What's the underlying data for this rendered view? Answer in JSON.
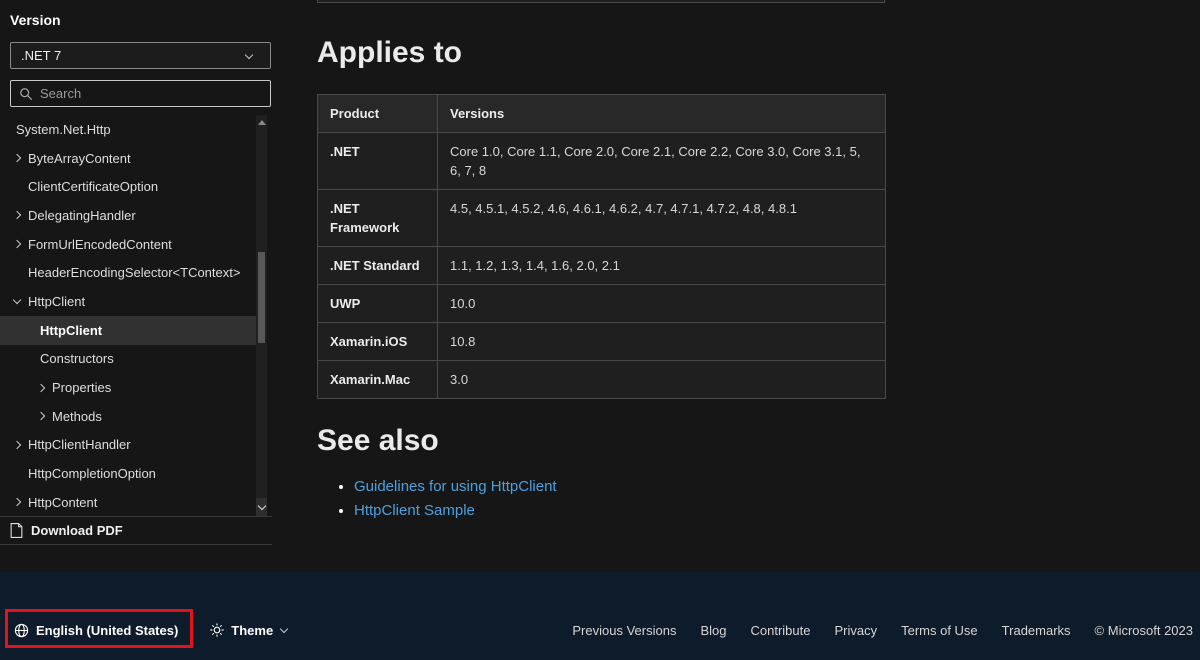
{
  "sidebar": {
    "version_label": "Version",
    "version_value": ".NET 7",
    "search_placeholder": "Search",
    "tree": [
      "System.Net.Http",
      "ByteArrayContent",
      "ClientCertificateOption",
      "DelegatingHandler",
      "FormUrlEncodedContent",
      "HeaderEncodingSelector<TContext>",
      "HttpClient",
      "HttpClient",
      "Constructors",
      "Properties",
      "Methods",
      "HttpClientHandler",
      "HttpCompletionOption",
      "HttpContent"
    ],
    "download_pdf_label": "Download PDF"
  },
  "main": {
    "heading_applies": "Applies to",
    "table": {
      "headers": [
        "Product",
        "Versions"
      ],
      "rows": [
        {
          "product": ".NET",
          "versions": "Core 1.0, Core 1.1, Core 2.0, Core 2.1, Core 2.2, Core 3.0, Core 3.1, 5, 6, 7, 8"
        },
        {
          "product": ".NET Framework",
          "versions": "4.5, 4.5.1, 4.5.2, 4.6, 4.6.1, 4.6.2, 4.7, 4.7.1, 4.7.2, 4.8, 4.8.1"
        },
        {
          "product": ".NET Standard",
          "versions": "1.1, 1.2, 1.3, 1.4, 1.6, 2.0, 2.1"
        },
        {
          "product": "UWP",
          "versions": "10.0"
        },
        {
          "product": "Xamarin.iOS",
          "versions": "10.8"
        },
        {
          "product": "Xamarin.Mac",
          "versions": "3.0"
        }
      ]
    },
    "heading_see_also": "See also",
    "see_also_links": [
      "Guidelines for using HttpClient",
      "HttpClient Sample"
    ]
  },
  "footer": {
    "language": "English (United States)",
    "theme_label": "Theme",
    "links": [
      "Previous Versions",
      "Blog",
      "Contribute",
      "Privacy",
      "Terms of Use",
      "Trademarks",
      "© Microsoft 2023"
    ]
  },
  "colors": {
    "link_blue": "#4ba0e0",
    "annotation_red": "#e3131b",
    "footer_background": "#0d1b2a"
  }
}
